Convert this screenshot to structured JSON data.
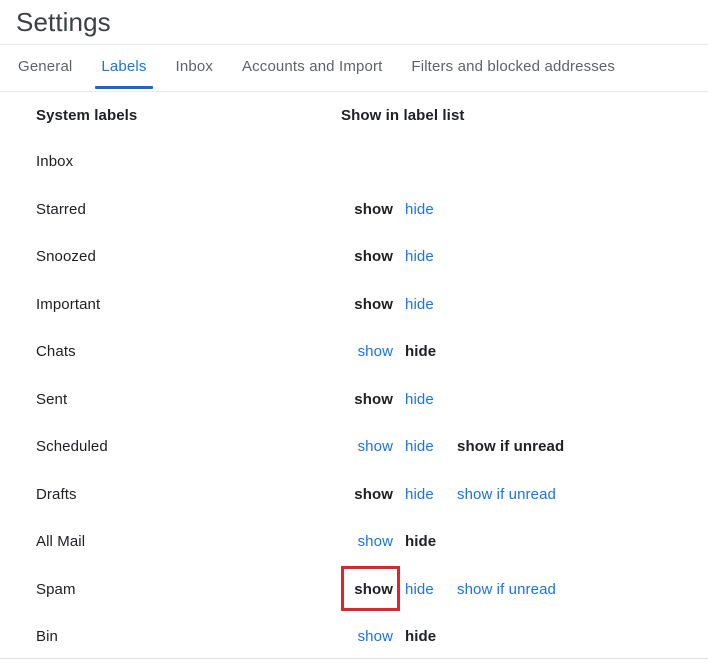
{
  "header": {
    "title": "Settings"
  },
  "tabs": [
    {
      "label": "General",
      "active": false
    },
    {
      "label": "Labels",
      "active": true
    },
    {
      "label": "Inbox",
      "active": false
    },
    {
      "label": "Accounts and Import",
      "active": false
    },
    {
      "label": "Filters and blocked addresses",
      "active": false
    }
  ],
  "table": {
    "columns": {
      "name": "System labels",
      "visibility": "Show in label list"
    },
    "option_labels": {
      "show": "show",
      "hide": "hide",
      "show_if_unread": "show if unread"
    },
    "rows": [
      {
        "name": "Inbox",
        "options": []
      },
      {
        "name": "Starred",
        "options": [
          {
            "key": "show",
            "label": "show",
            "state": "selected"
          },
          {
            "key": "hide",
            "label": "hide",
            "state": "link"
          }
        ]
      },
      {
        "name": "Snoozed",
        "options": [
          {
            "key": "show",
            "label": "show",
            "state": "selected"
          },
          {
            "key": "hide",
            "label": "hide",
            "state": "link"
          }
        ]
      },
      {
        "name": "Important",
        "options": [
          {
            "key": "show",
            "label": "show",
            "state": "selected"
          },
          {
            "key": "hide",
            "label": "hide",
            "state": "link"
          }
        ]
      },
      {
        "name": "Chats",
        "options": [
          {
            "key": "show",
            "label": "show",
            "state": "link"
          },
          {
            "key": "hide",
            "label": "hide",
            "state": "selected"
          }
        ]
      },
      {
        "name": "Sent",
        "options": [
          {
            "key": "show",
            "label": "show",
            "state": "selected"
          },
          {
            "key": "hide",
            "label": "hide",
            "state": "link"
          }
        ]
      },
      {
        "name": "Scheduled",
        "options": [
          {
            "key": "show",
            "label": "show",
            "state": "link"
          },
          {
            "key": "hide",
            "label": "hide",
            "state": "link"
          },
          {
            "key": "unread",
            "label": "show if unread",
            "state": "selected"
          }
        ]
      },
      {
        "name": "Drafts",
        "options": [
          {
            "key": "show",
            "label": "show",
            "state": "selected"
          },
          {
            "key": "hide",
            "label": "hide",
            "state": "link"
          },
          {
            "key": "unread",
            "label": "show if unread",
            "state": "link"
          }
        ]
      },
      {
        "name": "All Mail",
        "options": [
          {
            "key": "show",
            "label": "show",
            "state": "link"
          },
          {
            "key": "hide",
            "label": "hide",
            "state": "selected"
          }
        ]
      },
      {
        "name": "Spam",
        "options": [
          {
            "key": "show",
            "label": "show",
            "state": "selected",
            "highlighted": true
          },
          {
            "key": "hide",
            "label": "hide",
            "state": "link"
          },
          {
            "key": "unread",
            "label": "show if unread",
            "state": "link"
          }
        ]
      },
      {
        "name": "Bin",
        "options": [
          {
            "key": "show",
            "label": "show",
            "state": "link"
          },
          {
            "key": "hide",
            "label": "hide",
            "state": "selected"
          }
        ]
      }
    ]
  },
  "annotation": {
    "color": "#e52129",
    "target": "spam-show-option"
  }
}
